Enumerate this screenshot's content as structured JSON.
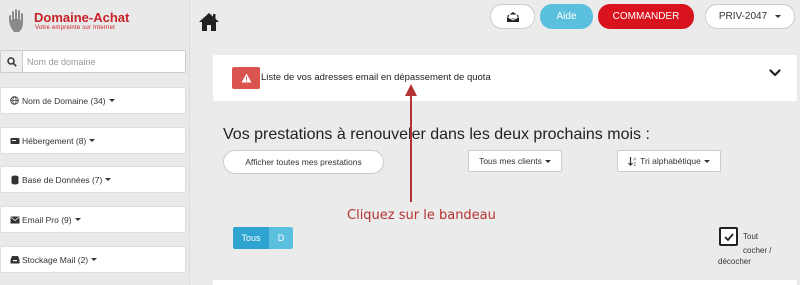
{
  "brand": {
    "title": "Domaine-Achat",
    "subtitle": "Votre empreinte sur Internet",
    "color": "#c8202a"
  },
  "sidebar": {
    "search": {
      "placeholder": "Nom de domaine",
      "value": ""
    },
    "items": [
      {
        "label": "Nom de Domaine (34)",
        "icon": "globe-icon"
      },
      {
        "label": "Hébergement (8)",
        "icon": "server-icon"
      },
      {
        "label": "Base de Données (7)",
        "icon": "database-icon"
      },
      {
        "label": "Email Pro (9)",
        "icon": "envelope-icon"
      },
      {
        "label": "Stockage Mail (2)",
        "icon": "inbox-icon"
      }
    ]
  },
  "topbar": {
    "aide_label": "Aide",
    "commander_label": "COMMANDER",
    "account_label": "PRIV-2047",
    "aide_color": "#5bc0de",
    "commander_color": "#d9131e"
  },
  "banner": {
    "text": "Liste de vos adresses email en dépassement de quota",
    "warning_color": "#d9534f"
  },
  "main": {
    "title": "Vos prestations à renouveler dans les deux prochains mois :",
    "show_all_label": "Afficher toutes mes prestations",
    "clients_label": "Tous mes clients",
    "sort_label": "Tri alphabétique",
    "filter_tous": "Tous",
    "filter_d": "D",
    "check_label_line1": "Tout cocher /",
    "check_label_line2": "décocher"
  },
  "annotation": {
    "text": "Cliquez sur le bandeau",
    "color": "#b53333"
  }
}
